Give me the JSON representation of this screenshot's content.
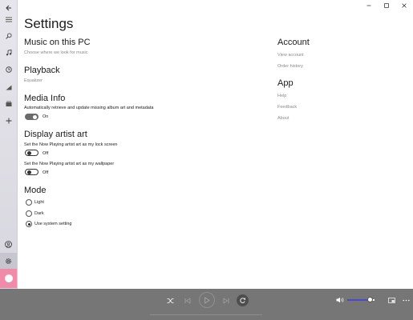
{
  "page_title": "Settings",
  "music": {
    "title": "Music on this PC",
    "subtitle": "Choose where we look for music"
  },
  "playback": {
    "title": "Playback",
    "subtitle": "Equalizer"
  },
  "media_info": {
    "title": "Media Info",
    "description": "Automatically retrieve and update missing album art and metadata",
    "toggle_state": "On"
  },
  "artist_art": {
    "title": "Display artist art",
    "lock_label": "Set the Now Playing artist art as my lock screen",
    "lock_state": "Off",
    "wallpaper_label": "Set the Now Playing artist art as my wallpaper",
    "wallpaper_state": "Off"
  },
  "mode": {
    "title": "Mode",
    "options": [
      "Light",
      "Dark",
      "Use system setting"
    ],
    "selected": "Use system setting"
  },
  "account": {
    "title": "Account",
    "links": [
      "View account",
      "Order history"
    ]
  },
  "app": {
    "title": "App",
    "links": [
      "Help",
      "Feedback",
      "About"
    ]
  },
  "sidebar": {
    "icons": [
      "back-icon",
      "menu-icon",
      "search-icon",
      "music-note-icon",
      "recent-icon",
      "chart-icon",
      "library-icon",
      "add-icon",
      "account-icon",
      "settings-icon",
      "now-playing-icon"
    ],
    "active": "settings-icon",
    "accent": "#f08caa"
  },
  "player": {
    "buttons": [
      "shuffle-icon",
      "previous-icon",
      "play-icon",
      "next-icon",
      "repeat-icon"
    ],
    "volume": 0.85,
    "bar_color": "#767676",
    "volume_color": "#4a4acb"
  }
}
